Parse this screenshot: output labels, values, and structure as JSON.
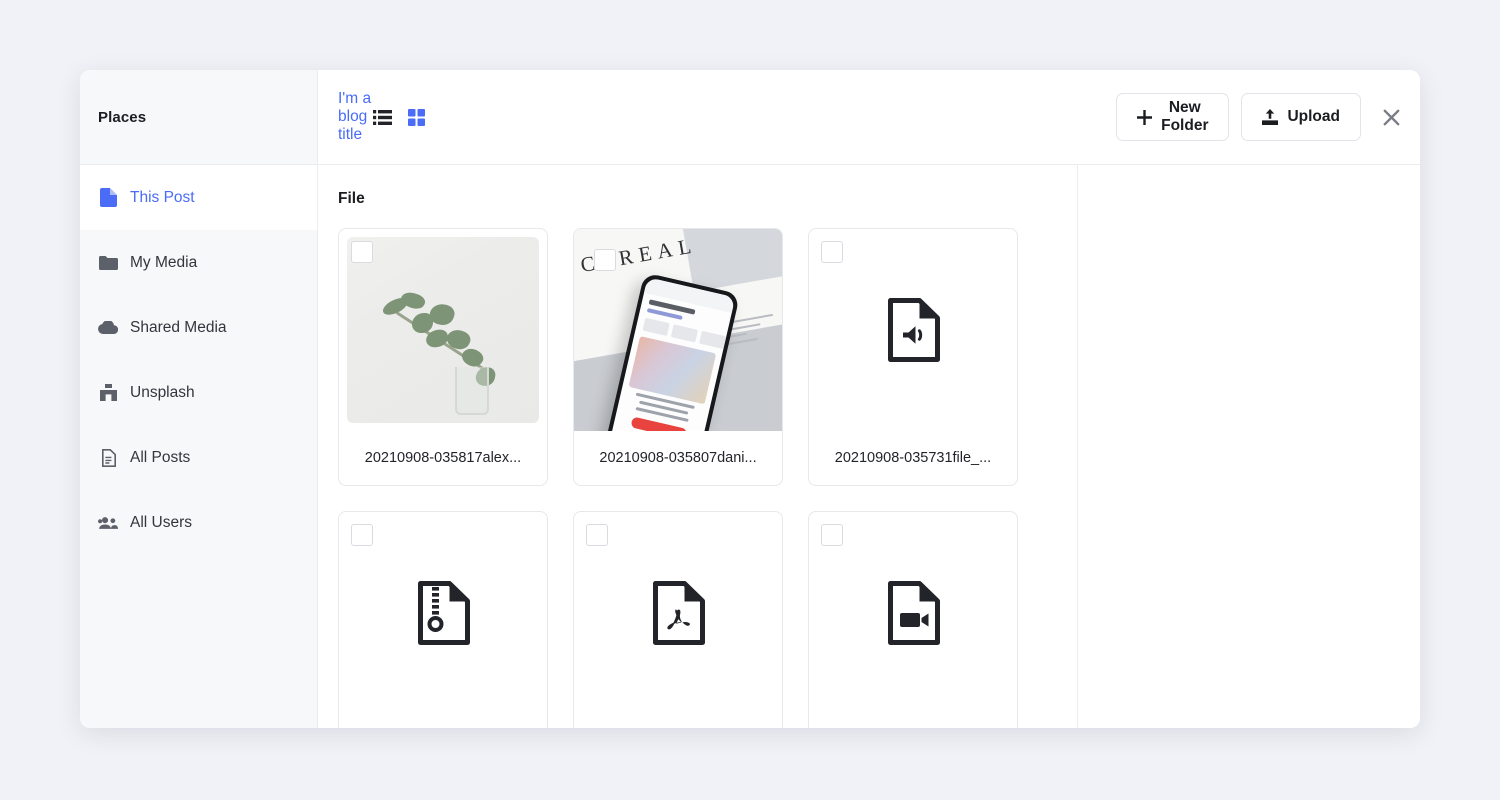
{
  "sidebar": {
    "title": "Places",
    "items": [
      {
        "label": "This Post",
        "icon": "file-icon",
        "active": true
      },
      {
        "label": "My Media",
        "icon": "folder-icon",
        "active": false
      },
      {
        "label": "Shared Media",
        "icon": "cloud-icon",
        "active": false
      },
      {
        "label": "Unsplash",
        "icon": "unsplash-icon",
        "active": false
      },
      {
        "label": "All Posts",
        "icon": "document-icon",
        "active": false
      },
      {
        "label": "All Users",
        "icon": "users-icon",
        "active": false
      }
    ]
  },
  "topbar": {
    "breadcrumb": "I'm a blog title",
    "view_list_label": "list-view",
    "view_grid_label": "grid-view",
    "active_view": "grid",
    "new_folder_label": "New Folder",
    "upload_label": "Upload",
    "close_label": "✕"
  },
  "main": {
    "section_title": "File",
    "files": [
      {
        "name": "20210908-035817alex...",
        "kind": "image-plant",
        "selected": false,
        "hover": false
      },
      {
        "name": "20210908-035807dani...",
        "kind": "image-phone",
        "selected": false,
        "hover": true
      },
      {
        "name": "20210908-035731file_...",
        "kind": "file-audio",
        "selected": false,
        "hover": false
      },
      {
        "name": "",
        "kind": "file-zip",
        "selected": false,
        "hover": false
      },
      {
        "name": "",
        "kind": "file-pdf",
        "selected": false,
        "hover": false
      },
      {
        "name": "",
        "kind": "file-video",
        "selected": false,
        "hover": false
      }
    ]
  },
  "colors": {
    "accent": "#4a6cf7",
    "page_background": "#f1f2f7",
    "sidebar_background": "#f7f8f9",
    "panel_background": "#ffffff",
    "border": "#ebecef",
    "text": "#1b1d21"
  },
  "thumb_text": {
    "cereal": "CEREAL"
  }
}
